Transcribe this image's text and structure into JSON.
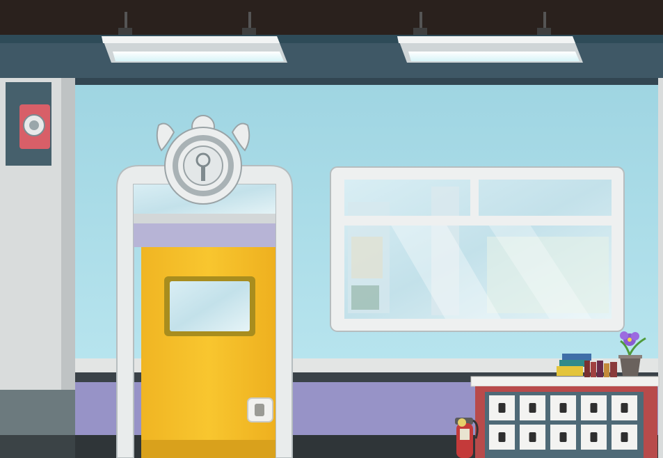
{
  "scene": {
    "palette": {
      "ceiling": "#2a211d",
      "wall_blue": "#a9dbe6",
      "trim_dark": "#3d5563",
      "pillar_gray": "#d9dcdc",
      "door_yellow": "#f6c02b",
      "lower_wall": "#9793c7",
      "cabinet_red": "#b84b4b"
    },
    "icons": [
      "ceiling-light-icon",
      "wall-speaker-icon",
      "winged-emblem-icon",
      "fire-extinguisher-icon",
      "flower-pot-icon",
      "books-icon"
    ]
  }
}
